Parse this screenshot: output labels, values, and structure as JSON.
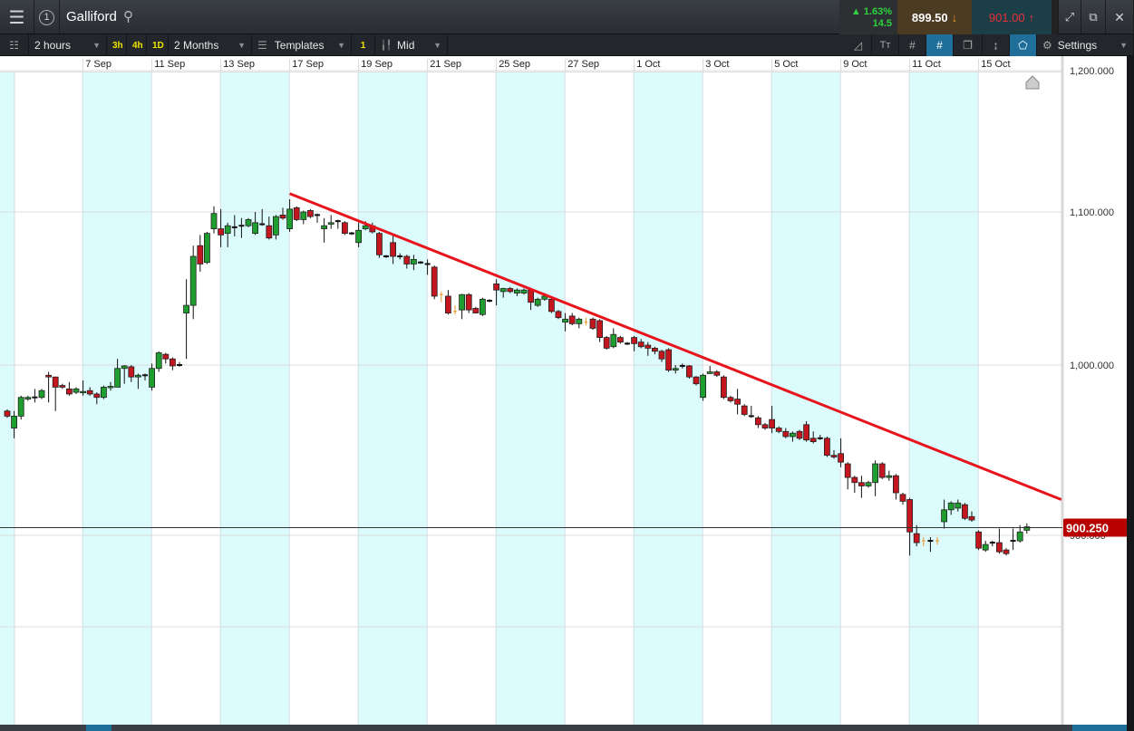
{
  "header": {
    "title": "Galliford",
    "change_pct": "1.63%",
    "change_abs": "14.5",
    "sell_price": "899.50",
    "buy_price": "901.00"
  },
  "toolbar": {
    "interval": "2 hours",
    "quick_intervals": [
      "3h",
      "4h",
      "1D"
    ],
    "range": "2 Months",
    "templates": "Templates",
    "count_badge": "1",
    "price_type": "Mid",
    "settings": "Settings"
  },
  "colors": {
    "up": "#1e9e2e",
    "down": "#c3161e",
    "neutral": "#e8962a",
    "trendline": "#e8141c",
    "price_tag": "#b80000",
    "shade": "#dcfbfd"
  },
  "chart_data": {
    "type": "candlestick",
    "title": "Galliford",
    "x_tick_labels": [
      {
        "index": 11,
        "label": "7 Sep"
      },
      {
        "index": 21,
        "label": "11 Sep"
      },
      {
        "index": 31,
        "label": "13 Sep"
      },
      {
        "index": 41,
        "label": "17 Sep"
      },
      {
        "index": 51,
        "label": "19 Sep"
      },
      {
        "index": 61,
        "label": "21 Sep"
      },
      {
        "index": 71,
        "label": "25 Sep"
      },
      {
        "index": 81,
        "label": "27 Sep"
      },
      {
        "index": 91,
        "label": "1 Oct"
      },
      {
        "index": 101,
        "label": "3 Oct"
      },
      {
        "index": 111,
        "label": "5 Oct"
      },
      {
        "index": 121,
        "label": "9 Oct"
      },
      {
        "index": 131,
        "label": "11 Oct"
      },
      {
        "index": 141,
        "label": "15 Oct"
      }
    ],
    "y_ticks": [
      {
        "value": 1200,
        "label": "1,200.000"
      },
      {
        "value": 1100,
        "label": "1,100.000"
      },
      {
        "value": 1000,
        "label": "1,000.000"
      },
      {
        "value": 900,
        "label": "900.000"
      },
      {
        "value": 850,
        "label": ""
      }
    ],
    "current_price": {
      "value": 900.25,
      "label": "900.250"
    },
    "trendline": {
      "start": {
        "index": 41,
        "price": 1113
      },
      "end": {
        "index": 153,
        "price": 921
      }
    },
    "neutral_indices": [
      63,
      65,
      84,
      133,
      135
    ],
    "ohlc": [
      [
        973,
        974,
        969,
        970
      ],
      [
        963,
        973,
        957,
        970
      ],
      [
        970,
        982,
        968,
        981
      ],
      [
        980,
        982,
        979,
        981
      ],
      [
        981,
        986,
        978,
        981
      ],
      [
        981,
        986,
        980,
        985
      ],
      [
        994,
        996,
        978,
        993
      ],
      [
        993,
        993,
        973,
        987
      ],
      [
        988,
        989,
        986,
        987
      ],
      [
        986,
        990,
        982,
        983
      ],
      [
        984,
        987,
        983,
        986
      ],
      [
        984,
        991,
        982,
        984.5
      ],
      [
        985,
        987,
        982,
        983
      ],
      [
        983,
        984,
        977,
        981
      ],
      [
        981,
        988,
        980,
        987
      ],
      [
        987,
        990,
        985,
        987.5
      ],
      [
        987,
        1004,
        987,
        998
      ],
      [
        998,
        1000,
        989,
        999.5
      ],
      [
        999,
        1000,
        990,
        993
      ],
      [
        993,
        995,
        986,
        994
      ],
      [
        994,
        995,
        991,
        994
      ],
      [
        987,
        1001,
        985,
        998
      ],
      [
        998,
        1009,
        996,
        1008
      ],
      [
        1007,
        1008,
        1001,
        1004
      ],
      [
        1004,
        1005,
        997,
        999.5
      ],
      [
        1000,
        1002,
        999,
        1000
      ],
      [
        1034,
        1056,
        1004,
        1039
      ],
      [
        1039,
        1078,
        1030,
        1071
      ],
      [
        1078,
        1085,
        1061,
        1066
      ],
      [
        1067,
        1087,
        1066,
        1086
      ],
      [
        1089,
        1104,
        1086,
        1099
      ],
      [
        1089,
        1102,
        1077,
        1085
      ],
      [
        1086,
        1093,
        1077,
        1091
      ],
      [
        1090,
        1098,
        1084,
        1090
      ],
      [
        1091,
        1096,
        1083,
        1091
      ],
      [
        1091,
        1096,
        1090,
        1095
      ],
      [
        1086,
        1100,
        1085,
        1093
      ],
      [
        1092,
        1102,
        1091,
        1092
      ],
      [
        1091,
        1097,
        1082,
        1083
      ],
      [
        1085,
        1098,
        1082,
        1097
      ],
      [
        1098,
        1103,
        1095,
        1096
      ],
      [
        1089,
        1109,
        1087,
        1102
      ],
      [
        1103,
        1104,
        1094,
        1095
      ],
      [
        1095,
        1101,
        1092,
        1100
      ],
      [
        1101,
        1102,
        1096,
        1097
      ],
      [
        1098,
        1099,
        1093,
        1098
      ],
      [
        1089,
        1096,
        1080,
        1091
      ],
      [
        1092,
        1098,
        1089,
        1093
      ],
      [
        1094,
        1095,
        1089,
        1094
      ],
      [
        1093,
        1094,
        1085,
        1086
      ],
      [
        1086,
        1087,
        1085,
        1086
      ],
      [
        1080,
        1093,
        1077,
        1088
      ],
      [
        1089,
        1094,
        1088,
        1091
      ],
      [
        1091,
        1093,
        1086,
        1087
      ],
      [
        1086,
        1087,
        1070,
        1072
      ],
      [
        1071,
        1072,
        1070,
        1071
      ],
      [
        1080,
        1085,
        1066,
        1071
      ],
      [
        1071,
        1073,
        1069,
        1071
      ],
      [
        1071,
        1072,
        1063,
        1066
      ],
      [
        1066,
        1072,
        1062,
        1069
      ],
      [
        1067,
        1068,
        1066,
        1067
      ],
      [
        1066,
        1069,
        1059,
        1066
      ],
      [
        1064,
        1065,
        1043,
        1045
      ],
      [
        1046,
        1048,
        1041,
        1046
      ],
      [
        1045,
        1049,
        1033,
        1034
      ],
      [
        1035,
        1039,
        1033,
        1035
      ],
      [
        1036,
        1046.5,
        1030,
        1046
      ],
      [
        1046,
        1047,
        1034,
        1036
      ],
      [
        1037,
        1038,
        1034,
        1034
      ],
      [
        1033,
        1044,
        1032,
        1043
      ],
      [
        1042,
        1043,
        1041,
        1042
      ],
      [
        1053,
        1056,
        1039,
        1049
      ],
      [
        1048,
        1050.5,
        1044,
        1050
      ],
      [
        1050,
        1051,
        1047,
        1048
      ],
      [
        1047,
        1050,
        1045,
        1049
      ],
      [
        1047,
        1050,
        1046,
        1049
      ],
      [
        1049,
        1050,
        1036,
        1041
      ],
      [
        1039,
        1044,
        1038,
        1043
      ],
      [
        1043,
        1047,
        1042,
        1045
      ],
      [
        1043,
        1044,
        1034,
        1035
      ],
      [
        1035,
        1036,
        1030,
        1031
      ],
      [
        1028,
        1034,
        1022,
        1030
      ],
      [
        1032,
        1034,
        1026,
        1027
      ],
      [
        1027,
        1031,
        1024,
        1030
      ],
      [
        1028,
        1031,
        1026,
        1028
      ],
      [
        1030,
        1031,
        1023,
        1024
      ],
      [
        1029,
        1030,
        1015,
        1018
      ],
      [
        1018,
        1019,
        1010,
        1011
      ],
      [
        1012,
        1024,
        1011,
        1020
      ],
      [
        1018,
        1019,
        1014,
        1015
      ],
      [
        1014,
        1015,
        1013,
        1014
      ],
      [
        1018,
        1019,
        1009,
        1014
      ],
      [
        1015,
        1017,
        1011,
        1012
      ],
      [
        1013,
        1015,
        1006,
        1011
      ],
      [
        1011,
        1012,
        1007,
        1009
      ],
      [
        1009,
        1010,
        1002,
        1004
      ],
      [
        1010,
        1011,
        996,
        997
      ],
      [
        997,
        1000,
        995,
        998
      ],
      [
        999.5,
        1001,
        998,
        999.5
      ],
      [
        999.5,
        1000,
        992,
        993
      ],
      [
        993,
        993.5,
        988,
        989
      ],
      [
        981,
        995,
        979,
        994
      ],
      [
        995,
        999.5,
        995,
        996
      ],
      [
        996,
        997,
        993,
        994
      ],
      [
        993,
        994,
        980,
        981
      ],
      [
        981,
        982,
        978,
        979
      ],
      [
        980,
        986,
        971,
        977
      ],
      [
        976,
        977,
        970,
        971
      ],
      [
        970,
        976,
        969,
        970
      ],
      [
        969,
        970,
        963,
        965
      ],
      [
        965,
        966,
        962,
        963
      ],
      [
        968,
        976,
        960,
        963
      ],
      [
        963,
        964,
        960,
        961
      ],
      [
        961,
        963,
        957,
        958
      ],
      [
        958,
        961,
        955,
        960
      ],
      [
        961,
        962,
        956,
        957
      ],
      [
        965,
        967,
        955,
        956
      ],
      [
        957,
        961,
        954,
        955
      ],
      [
        957,
        959,
        956,
        957
      ],
      [
        957,
        958,
        946,
        947
      ],
      [
        947,
        950,
        945,
        946
      ],
      [
        948,
        957,
        940,
        943
      ],
      [
        942,
        943,
        927,
        934
      ],
      [
        934,
        935,
        925,
        931
      ],
      [
        931,
        935,
        922,
        929
      ],
      [
        929,
        932,
        928,
        931
      ],
      [
        931,
        944,
        923,
        942
      ],
      [
        942,
        943,
        933,
        934
      ],
      [
        934,
        938,
        932,
        935
      ],
      [
        935,
        936,
        921,
        925
      ],
      [
        924,
        925,
        918,
        920
      ],
      [
        921,
        922,
        889,
        902
      ],
      [
        901,
        906,
        894,
        896
      ],
      [
        897,
        899,
        894,
        897
      ],
      [
        897,
        899,
        891,
        897
      ],
      [
        897,
        899,
        895,
        897
      ],
      [
        908,
        921,
        904,
        915
      ],
      [
        915,
        920,
        912,
        919
      ],
      [
        916,
        921,
        914,
        919
      ],
      [
        918,
        919,
        909,
        910
      ],
      [
        911,
        914,
        908,
        909
      ],
      [
        902,
        903,
        892,
        893
      ],
      [
        892,
        897,
        891,
        895
      ],
      [
        896,
        897,
        894,
        896
      ],
      [
        896,
        904,
        890,
        891
      ],
      [
        892,
        893,
        889,
        890
      ],
      [
        897,
        904,
        892,
        897
      ],
      [
        897,
        906,
        896,
        902
      ],
      [
        903,
        907,
        901,
        905
      ]
    ]
  }
}
